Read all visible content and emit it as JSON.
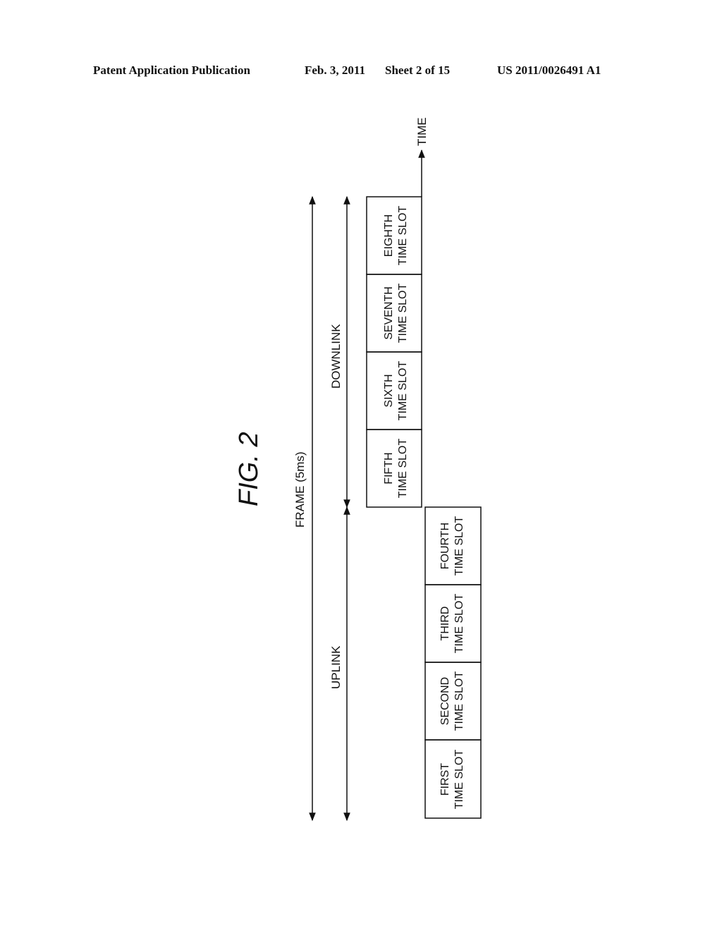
{
  "header": {
    "publication": "Patent Application Publication",
    "date": "Feb. 3, 2011",
    "sheet": "Sheet 2 of 15",
    "number": "US 2011/0026491 A1"
  },
  "figure": {
    "title": "FIG. 2",
    "time_label": "TIME",
    "frame_label": "FRAME (5ms)",
    "downlink_label": "DOWNLINK",
    "uplink_label": "UPLINK",
    "downlink_slots": [
      {
        "line1": "FIFTH",
        "line2": "TIME SLOT"
      },
      {
        "line1": "SIXTH",
        "line2": "TIME SLOT"
      },
      {
        "line1": "SEVENTH",
        "line2": "TIME SLOT"
      },
      {
        "line1": "EIGHTH",
        "line2": "TIME SLOT"
      }
    ],
    "uplink_slots": [
      {
        "line1": "FIRST",
        "line2": "TIME SLOT"
      },
      {
        "line1": "SECOND",
        "line2": "TIME SLOT"
      },
      {
        "line1": "THIRD",
        "line2": "TIME SLOT"
      },
      {
        "line1": "FOURTH",
        "line2": "TIME SLOT"
      }
    ]
  }
}
